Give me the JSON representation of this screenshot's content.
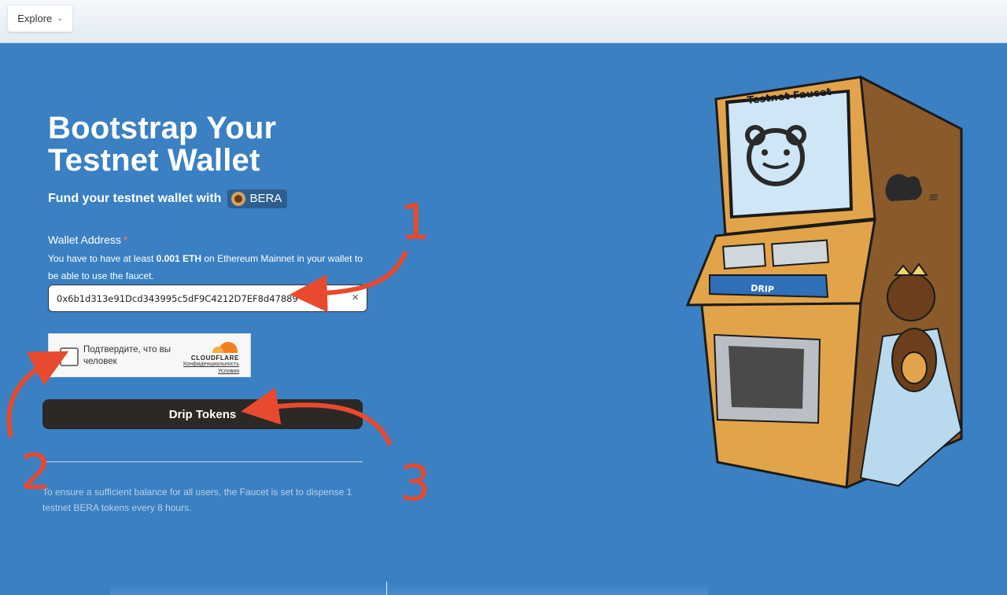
{
  "topbar": {
    "explore_label": "Explore"
  },
  "hero": {
    "title_line1": "Bootstrap Your",
    "title_line2": "Testnet Wallet",
    "subtitle": "Fund your testnet wallet with",
    "token_badge": "BERA"
  },
  "form": {
    "wallet_label": "Wallet Address",
    "required_mark": "*",
    "help_prefix": "You have to have at least ",
    "help_amount": "0.001 ETH",
    "help_suffix": " on Ethereum Mainnet in your wallet to be able to use the faucet.",
    "wallet_value": "0x6b1d313e91Dcd343995c5dF9C4212D7EF8d47889",
    "clear_icon": "×"
  },
  "captcha": {
    "prompt": "Подтвердите, что вы человек",
    "brand": "CLOUDFLARE",
    "privacy_link": "Конфиденциальность",
    "terms_link": "Условия"
  },
  "drip": {
    "button_label": "Drip Tokens"
  },
  "footnote": "To ensure a sufficient balance for all users, the Faucet is set to dispense 1 testnet BERA tokens every 8 hours.",
  "illustration": {
    "machine_title": "Testnet Faucet",
    "drip_label": "DRIP"
  },
  "annotations": {
    "step1": "1",
    "step2": "2",
    "step3": "3",
    "arrow_color": "#e84a2f"
  },
  "colors": {
    "background": "#3a80c2",
    "button": "#2b2825",
    "machine": "#e2a44a"
  }
}
